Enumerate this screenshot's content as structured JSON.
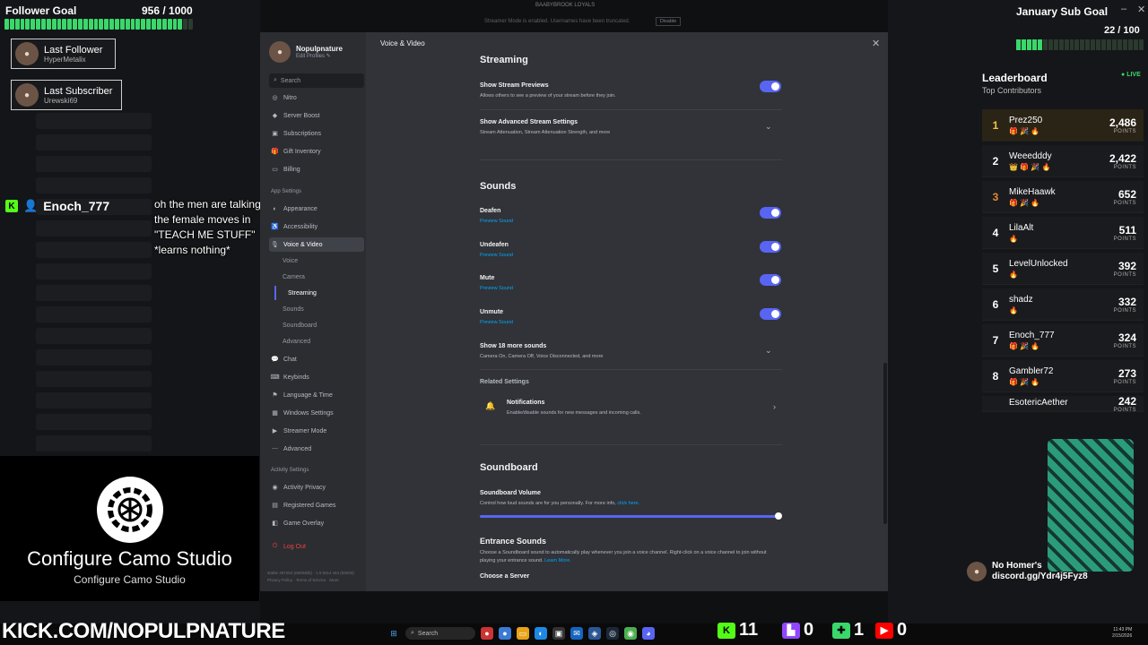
{
  "overlay": {
    "follower_goal": {
      "title": "Follower Goal",
      "count": "956 / 1000",
      "progress": 0.956
    },
    "last_follower": {
      "label": "Last Follower",
      "name": "HyperMetalix"
    },
    "last_subscriber": {
      "label": "Last Subscriber",
      "name": "Urewski69"
    },
    "chat": {
      "badge": "K",
      "username": "Enoch_777",
      "message": "oh the men are talking and the female moves in \"TEACH ME STUFF\" *learns nothing*"
    },
    "camo": {
      "title": "Configure Camo Studio",
      "subtitle": "Configure Camo Studio"
    },
    "sub_goal": {
      "title": "January Sub Goal",
      "count": "22 / 100",
      "progress": 0.22
    },
    "leaderboard": {
      "title": "Leaderboard",
      "subtitle": "Top Contributors",
      "live": "LIVE",
      "points_label": "POINTS",
      "rows": [
        {
          "rank": "1",
          "name": "Prez250",
          "points": "2,486",
          "icons": "🎁 🎉 🔥"
        },
        {
          "rank": "2",
          "name": "Weeedddy",
          "points": "2,422",
          "icons": "👑 🎁 🎉 🔥"
        },
        {
          "rank": "3",
          "name": "MikeHaawk",
          "points": "652",
          "icons": "🎁 🎉 🔥"
        },
        {
          "rank": "4",
          "name": "LilaAlt",
          "points": "511",
          "icons": "🔥"
        },
        {
          "rank": "5",
          "name": "LevelUnlocked",
          "points": "392",
          "icons": "🔥"
        },
        {
          "rank": "6",
          "name": "shadz",
          "points": "332",
          "icons": "🔥"
        },
        {
          "rank": "7",
          "name": "Enoch_777",
          "points": "324",
          "icons": "🎁 🎉 🔥"
        },
        {
          "rank": "8",
          "name": "Gambler72",
          "points": "273",
          "icons": "🎁 🎉 🔥"
        },
        {
          "rank": "",
          "name": "EsotericAether",
          "points": "242",
          "icons": ""
        }
      ]
    },
    "homer": {
      "line1": "No Homer's",
      "line2": "discord.gg/Ydr4j5Fyz8"
    },
    "kick_url": "KICK.COM/NOPULPNATURE",
    "stats": {
      "kick": "11",
      "twitch": "0",
      "plus": "1",
      "youtube": "0"
    }
  },
  "banner": {
    "server": "BAABYBROOK LOYALS",
    "message": "Streamer Mode is enabled. Usernames have been truncated.",
    "button": "Disable"
  },
  "settings": {
    "user": {
      "name": "Nopulpnature",
      "edit": "Edit Profiles"
    },
    "search_placeholder": "Search",
    "nav_top": [
      {
        "label": "Nitro",
        "icon": "nitro-icon"
      },
      {
        "label": "Server Boost",
        "icon": "boost-icon"
      },
      {
        "label": "Subscriptions",
        "icon": "subscriptions-icon"
      },
      {
        "label": "Gift Inventory",
        "icon": "gift-icon"
      },
      {
        "label": "Billing",
        "icon": "billing-icon"
      }
    ],
    "app_settings_label": "App Settings",
    "nav_app": [
      {
        "label": "Appearance"
      },
      {
        "label": "Accessibility"
      },
      {
        "label": "Voice & Video"
      }
    ],
    "nav_voice_sub": [
      "Voice",
      "Camera",
      "Streaming",
      "Sounds",
      "Soundboard",
      "Advanced"
    ],
    "nav_more": [
      "Chat",
      "Keybinds",
      "Language & Time",
      "Windows Settings",
      "Streamer Mode",
      "Advanced"
    ],
    "activity_label": "Activity Settings",
    "nav_activity": [
      "Activity Privacy",
      "Registered Games",
      "Game Overlay"
    ],
    "logout": "Log Out",
    "version": "stable 497254 (e8294bb) · 1.0.9214 x64 (55034)",
    "footer_links": "Privacy Policy · Terms of Service · More",
    "breadcrumb": "Voice & Video",
    "streaming": {
      "heading": "Streaming",
      "show_previews": {
        "title": "Show Stream Previews",
        "desc": "Allows others to see a preview of your stream before they join."
      },
      "advanced": {
        "title": "Show Advanced Stream Settings",
        "desc": "Stream Attenuation, Stream Attenuation Strength, and more"
      }
    },
    "sounds": {
      "heading": "Sounds",
      "preview_label": "Preview Sound",
      "items": [
        "Deafen",
        "Undeafen",
        "Mute",
        "Unmute"
      ],
      "more": {
        "title": "Show 18 more sounds",
        "desc": "Camera On, Camera Off, Voice Disconnected, and more"
      }
    },
    "related": {
      "heading": "Related Settings",
      "notifications": {
        "title": "Notifications",
        "desc": "Enable/disable sounds for new messages and incoming calls."
      }
    },
    "soundboard": {
      "heading": "Soundboard",
      "volume_title": "Soundboard Volume",
      "volume_desc": "Control how loud sounds are for you personally. For more info,",
      "volume_link": "click here.",
      "volume": 1.0
    },
    "entrance": {
      "heading": "Entrance Sounds",
      "desc": "Choose a Soundboard sound to automatically play whenever you join a voice channel. Right-click on a voice channel to join without playing your entrance sound.",
      "learn_more": "Learn More.",
      "choose_server": "Choose a Server"
    }
  },
  "taskbar": {
    "search": "Search",
    "clock": "11:43 PM\n2/15/2026"
  },
  "colors": {
    "accent": "#5865f2",
    "kick": "#53fc18",
    "goal": "#3ad86b",
    "twitch": "#9146ff",
    "youtube": "#ff0000"
  }
}
